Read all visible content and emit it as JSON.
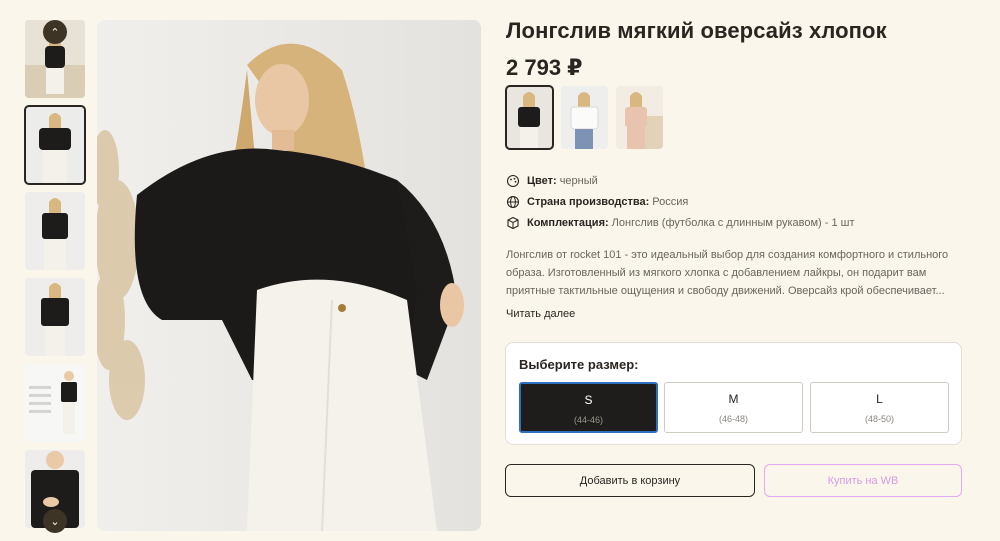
{
  "product": {
    "title": "Лонгслив мягкий оверсайз хлопок",
    "price": "2 793 ₽"
  },
  "gallery": {
    "prev_icon": "chevron-up-icon",
    "next_icon": "chevron-down-icon",
    "thumbnails": [
      {
        "label": "photo-1"
      },
      {
        "label": "photo-2",
        "active": true
      },
      {
        "label": "photo-3"
      },
      {
        "label": "photo-4"
      },
      {
        "label": "photo-5"
      },
      {
        "label": "photo-6"
      }
    ]
  },
  "color_options": [
    {
      "name": "black",
      "active": true
    },
    {
      "name": "white"
    },
    {
      "name": "beige"
    }
  ],
  "properties": [
    {
      "icon": "palette-icon",
      "key": "Цвет:",
      "value": "черный"
    },
    {
      "icon": "globe-icon",
      "key": "Страна производства:",
      "value": "Россия"
    },
    {
      "icon": "box-icon",
      "key": "Комплектация:",
      "value": "Лонгслив (футболка с длинным рукавом) - 1 шт"
    }
  ],
  "description": {
    "text": "Лонгслив от rocket 101 - это идеальный выбор для создания комфортного и стильного образа. Изготовленный из мягкого хлопка с добавлением лайкры, он подарит вам приятные тактильные ощущения и свободу движений. Оверсайз крой обеспечивает...",
    "read_more": "Читать далее"
  },
  "sizes": {
    "title": "Выберите размер:",
    "options": [
      {
        "label": "S",
        "range": "(44-46)",
        "active": true
      },
      {
        "label": "M",
        "range": "(46-48)"
      },
      {
        "label": "L",
        "range": "(48-50)"
      }
    ]
  },
  "actions": {
    "add_to_cart": "Добавить в корзину",
    "buy_wb": "Купить на WB"
  },
  "colors": {
    "background": "#faf6ec",
    "text": "#2a2520",
    "selected_size_bg": "#1e1d1b",
    "selected_size_border": "#2f6fbf",
    "wb_accent": "#e7a9ef"
  }
}
